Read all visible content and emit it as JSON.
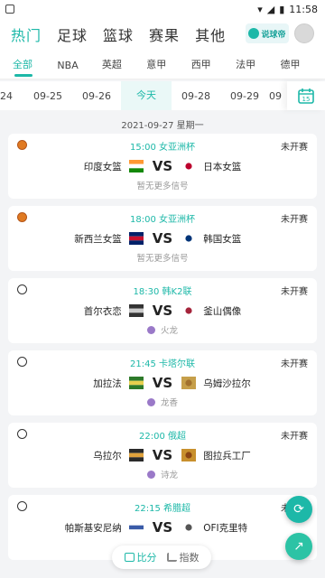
{
  "statusbar": {
    "time": "11:58"
  },
  "topnav": {
    "tabs": [
      "热门",
      "足球",
      "篮球",
      "赛果",
      "其他"
    ],
    "active": 0,
    "brand_label": "说球帝"
  },
  "leagues": {
    "items": [
      "全部",
      "NBA",
      "英超",
      "意甲",
      "西甲",
      "法甲",
      "德甲"
    ],
    "active": 0
  },
  "dates": {
    "items": [
      "24",
      "09-25",
      "09-26",
      "今天",
      "09-28",
      "09-29",
      "09"
    ],
    "today_index": 3,
    "calendar_number": "15"
  },
  "day_header": "2021-09-27 星期一",
  "matches": [
    {
      "sport": "basketball",
      "time_comp": "15:00 女亚洲杯",
      "status": "未开赛",
      "home": "印度女篮",
      "away": "日本女篮",
      "vs": "VS",
      "sub": "暂无更多信号",
      "sub_person": false
    },
    {
      "sport": "basketball",
      "time_comp": "18:00 女亚洲杯",
      "status": "未开赛",
      "home": "新西兰女篮",
      "away": "韩国女篮",
      "vs": "VS",
      "sub": "暂无更多信号",
      "sub_person": false
    },
    {
      "sport": "soccer",
      "time_comp": "18:30 韩K2联",
      "status": "未开赛",
      "home": "首尔衣恋",
      "away": "釜山偶像",
      "vs": "VS",
      "sub": "火龙",
      "sub_person": true
    },
    {
      "sport": "soccer",
      "time_comp": "21:45 卡塔尔联",
      "status": "未开赛",
      "home": "加拉法",
      "away": "乌姆沙拉尔",
      "vs": "VS",
      "sub": "龙香",
      "sub_person": true
    },
    {
      "sport": "soccer",
      "time_comp": "22:00 俄超",
      "status": "未开赛",
      "home": "乌拉尔",
      "away": "图拉兵工厂",
      "vs": "VS",
      "sub": "诗龙",
      "sub_person": true
    },
    {
      "sport": "soccer",
      "time_comp": "22:15 希腊超",
      "status": "未开赛",
      "home": "帕斯基安尼纳",
      "away": "OFI克里特",
      "vs": "VS",
      "sub": "",
      "sub_person": false
    }
  ],
  "bottom_tabs": {
    "score": "比分",
    "index": "指数"
  },
  "colors": {
    "accent": "#1db8a8"
  }
}
